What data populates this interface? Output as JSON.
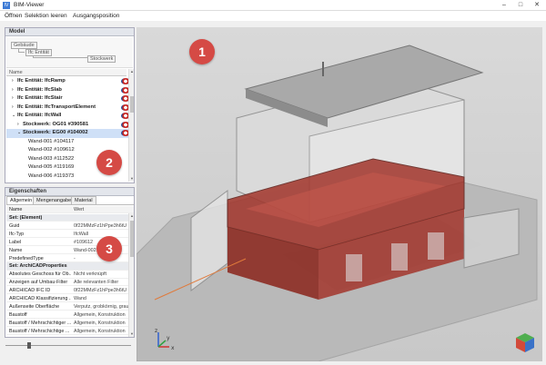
{
  "window": {
    "title": "BIM-Viewer",
    "app_icon": "IV",
    "minimize": "–",
    "maximize": "□",
    "close": "✕"
  },
  "menu": {
    "items": [
      "Öffnen",
      "Selektion leeren",
      "Ausgangsposition"
    ]
  },
  "model_panel": {
    "title": "Model",
    "group_boxes": [
      "Gebäude",
      "Ifc Entität",
      "Stockwerk"
    ],
    "column_header": "Name",
    "tree": [
      {
        "label": "Ifc Entität: IfcRamp",
        "bold": true,
        "arrow": "›",
        "indent": 1
      },
      {
        "label": "Ifc Entität: IfcSlab",
        "bold": true,
        "arrow": "›",
        "indent": 1
      },
      {
        "label": "Ifc Entität: IfcStair",
        "bold": true,
        "arrow": "›",
        "indent": 1
      },
      {
        "label": "Ifc Entität: IfcTransportElement",
        "bold": true,
        "arrow": "›",
        "indent": 1
      },
      {
        "label": "Ifc Entität: IfcWall",
        "bold": true,
        "arrow": "⌄",
        "indent": 1
      },
      {
        "label": "Stockwerk: OG01 #390581",
        "bold": true,
        "arrow": "›",
        "indent": 2
      },
      {
        "label": "Stockwerk: EG00 #104002",
        "bold": true,
        "arrow": "⌄",
        "indent": 2,
        "selected": true
      },
      {
        "label": "Wand-001 #104117",
        "bold": false,
        "arrow": "",
        "indent": 3
      },
      {
        "label": "Wand-002 #109612",
        "bold": false,
        "arrow": "",
        "indent": 3
      },
      {
        "label": "Wand-003 #112522",
        "bold": false,
        "arrow": "",
        "indent": 3
      },
      {
        "label": "Wand-005 #119169",
        "bold": false,
        "arrow": "",
        "indent": 3
      },
      {
        "label": "Wand-006 #119373",
        "bold": false,
        "arrow": "",
        "indent": 3
      }
    ]
  },
  "properties_panel": {
    "title": "Eigenschaften",
    "tabs": [
      "Allgemein",
      "Mengenangaben",
      "Material"
    ],
    "columns": [
      "Name",
      "Wert"
    ],
    "rows": [
      {
        "section": true,
        "key": "Set: (Element)",
        "value": ""
      },
      {
        "key": "Guid",
        "value": "0f22MMzFz1hPpe3h6tU"
      },
      {
        "key": "Ifc-Typ",
        "value": "IfcWall"
      },
      {
        "key": "Label",
        "value": "#109612"
      },
      {
        "key": "Name",
        "value": "Wand-002"
      },
      {
        "key": "PredefinedType",
        "value": "-"
      },
      {
        "section": true,
        "key": "Set: ArchiCADProperties",
        "value": ""
      },
      {
        "key": "Absolutes Geschoss für Ob...",
        "value": "Nicht verknüpft"
      },
      {
        "key": "Anzeigen auf Umbau-Filter",
        "value": "Alle relevanten Filter"
      },
      {
        "key": "ARCHICAD IFC ID",
        "value": "0f22MMzFz1hPpe3h6tU"
      },
      {
        "key": "ARCHICAD Klassifizierung ...",
        "value": "Wand"
      },
      {
        "key": "Außenseite Oberfläche",
        "value": "Verputz, grobkörnig, grau"
      },
      {
        "key": "Baustoff",
        "value": "Allgemein, Konstruktion"
      },
      {
        "key": "Baustoff / Mehrschichtiger ...",
        "value": "Allgemein, Konstruktion"
      },
      {
        "key": "Baustoff / Mehrschichtige ...",
        "value": "Allgemein, Konstruktion"
      }
    ]
  },
  "viewport": {
    "markers": [
      "1",
      "2",
      "3"
    ],
    "axis_labels": {
      "z": "z",
      "y": "y",
      "x": "x"
    },
    "colors": {
      "background": "#cfcfcf",
      "selection": "#a2352b",
      "marker": "#d54a45"
    }
  }
}
